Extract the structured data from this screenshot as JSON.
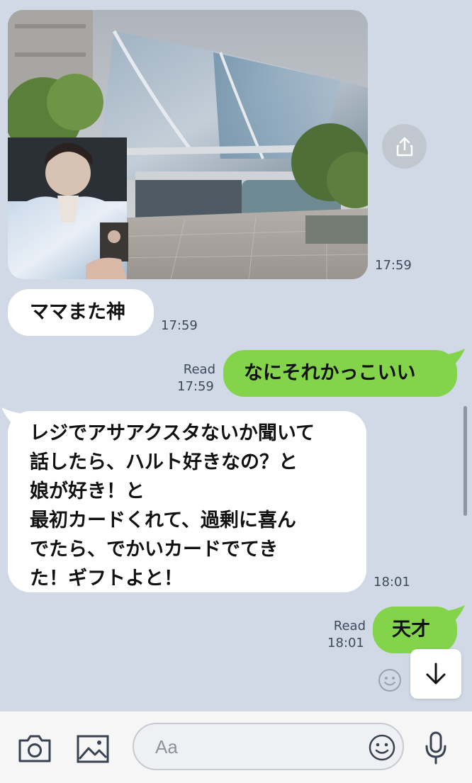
{
  "messages": [
    {
      "type": "image",
      "side": "in",
      "time": "17:59"
    },
    {
      "type": "text",
      "side": "in",
      "text": "ママまた神",
      "time": "17:59"
    },
    {
      "type": "text",
      "side": "out",
      "text": "なにそれかっこいい",
      "status": "Read",
      "time": "17:59"
    },
    {
      "type": "text",
      "side": "in",
      "text": "レジでアサアクスタないか聞いて\n話したら、ハルト好きなの？と\n娘が好き！と\n最初カードくれて、過剰に喜ん\nでたら、でかいカードでてき\nた！ギフトよと！",
      "time": "18:01"
    },
    {
      "type": "text",
      "side": "out",
      "text": "天才",
      "status": "Read",
      "time": "18:01"
    }
  ],
  "icons": {
    "share": "share-icon",
    "scroll_down": "arrow-down-icon",
    "sticker": "smiley-icon",
    "camera": "camera-icon",
    "gallery": "image-icon",
    "emoji": "smiley-icon",
    "mic": "microphone-icon"
  },
  "input": {
    "placeholder": "Aa"
  },
  "colors": {
    "background": "#d0d9e5",
    "incoming_bubble": "#ffffff",
    "outgoing_bubble": "#83d44a"
  }
}
